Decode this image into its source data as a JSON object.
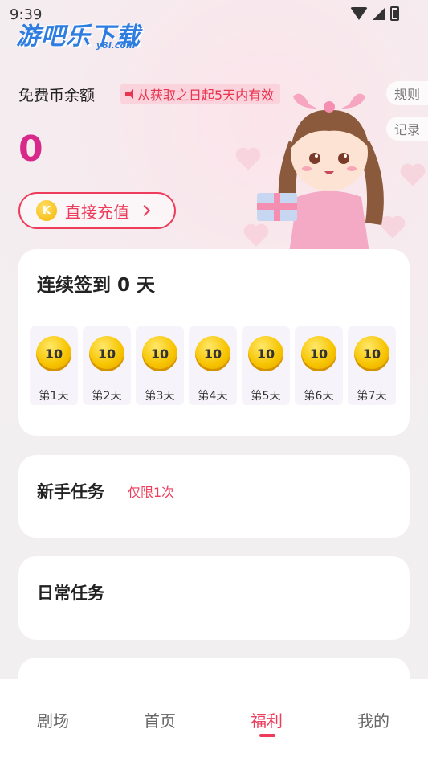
{
  "status_bar": {
    "time": "9:39"
  },
  "watermark": {
    "title": "游吧乐下载",
    "sub": "y8l.com"
  },
  "balance": {
    "label": "免费币余额",
    "validity_note": "从获取之日起5天内有效",
    "value": "0",
    "recharge_coin": "K",
    "recharge_label": "直接充值"
  },
  "side_buttons": {
    "rules": "规则",
    "records": "记录"
  },
  "checkin": {
    "title": "连续签到 0 天",
    "days": [
      {
        "coins": "10",
        "label": "第1天"
      },
      {
        "coins": "10",
        "label": "第2天"
      },
      {
        "coins": "10",
        "label": "第3天"
      },
      {
        "coins": "10",
        "label": "第4天"
      },
      {
        "coins": "10",
        "label": "第5天"
      },
      {
        "coins": "10",
        "label": "第6天"
      },
      {
        "coins": "10",
        "label": "第7天"
      }
    ]
  },
  "tasks": {
    "newbie": {
      "title": "新手任务",
      "badge": "仅限1次"
    },
    "daily": {
      "title": "日常任务"
    }
  },
  "nav": {
    "items": [
      {
        "label": "剧场"
      },
      {
        "label": "首页"
      },
      {
        "label": "福利"
      },
      {
        "label": "我的"
      }
    ],
    "active_index": 2
  },
  "colors": {
    "accent": "#ee3d5c",
    "balance": "#d8288a",
    "coin": "#f7c400"
  }
}
